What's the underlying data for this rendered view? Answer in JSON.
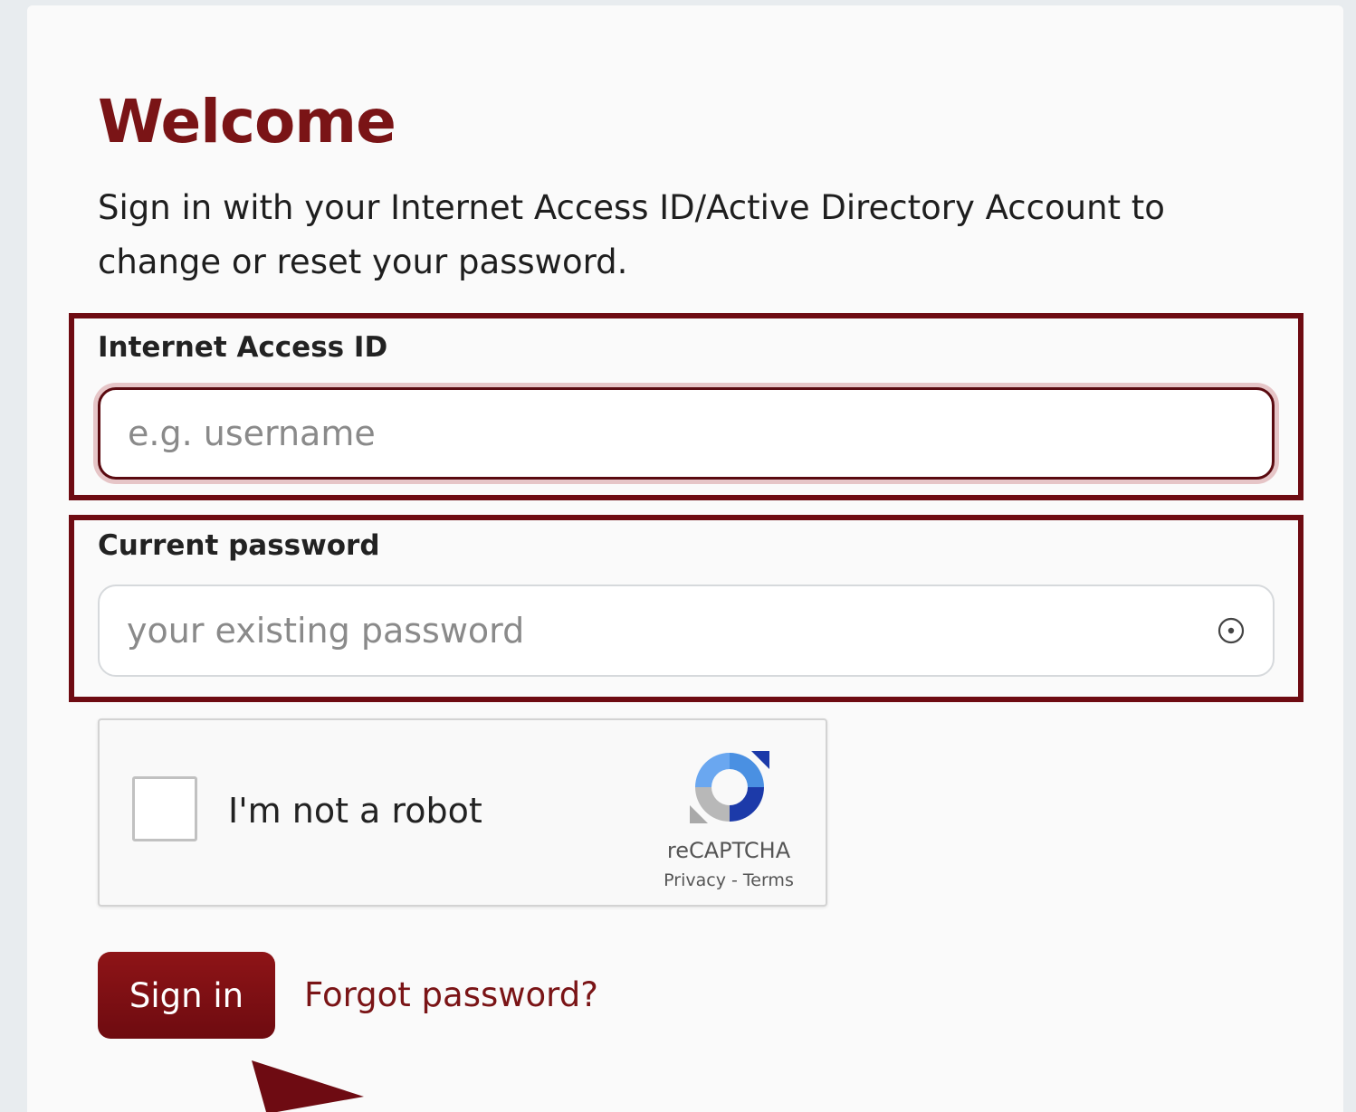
{
  "heading": "Welcome",
  "intro": "Sign in with your Internet Access ID/Active Directory Account to change or reset your password.",
  "form": {
    "id_field": {
      "label": "Internet Access ID",
      "value": "",
      "placeholder": "e.g. username"
    },
    "password_field": {
      "label": "Current password",
      "value": "",
      "placeholder": "your existing password",
      "toggle_icon": "show-password-icon"
    }
  },
  "captcha": {
    "checked": false,
    "label": "I'm not a robot",
    "brand": "reCAPTCHA",
    "privacy_link": "Privacy",
    "separator": " - ",
    "terms_link": "Terms"
  },
  "actions": {
    "sign_in_label": "Sign in",
    "forgot_label": "Forgot password?"
  },
  "colors": {
    "accent": "#7a1416",
    "button": "#8e1417",
    "highlight_border": "#6e0b12",
    "page_background": "#e8ecef",
    "card_background": "#fafafa"
  }
}
